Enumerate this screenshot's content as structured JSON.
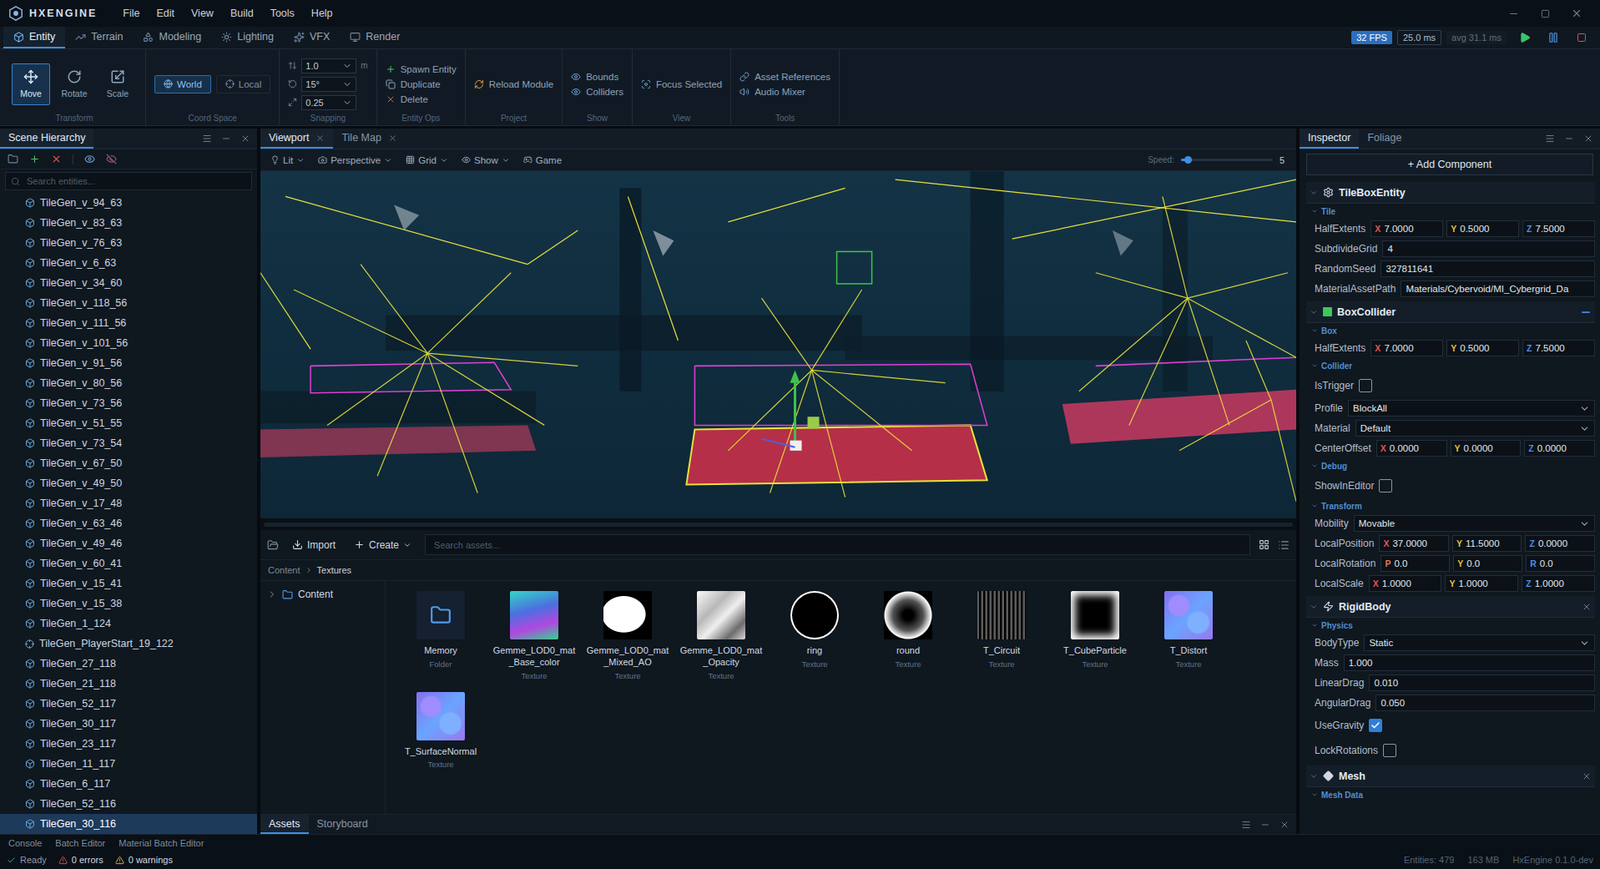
{
  "window": {
    "logo": "HXENGINE",
    "menu": [
      "File",
      "Edit",
      "View",
      "Build",
      "Tools",
      "Help"
    ]
  },
  "mode_tabs": [
    {
      "label": "Entity",
      "selected": true
    },
    {
      "label": "Terrain",
      "selected": false
    },
    {
      "label": "Modeling",
      "selected": false
    },
    {
      "label": "Lighting",
      "selected": false
    },
    {
      "label": "VFX",
      "selected": false
    },
    {
      "label": "Render",
      "selected": false
    }
  ],
  "perf": {
    "fps": "32 FPS",
    "frame": "25.0 ms",
    "avg": "avg 31.1 ms"
  },
  "ribbon": [
    {
      "title": "Transform",
      "kind": "tools",
      "items": [
        {
          "label": "Move",
          "selected": true
        },
        {
          "label": "Rotate",
          "selected": false
        },
        {
          "label": "Scale",
          "selected": false
        }
      ]
    },
    {
      "title": "Coord Space",
      "kind": "toggle",
      "items": [
        {
          "label": "World",
          "selected": true
        },
        {
          "label": "Local",
          "selected": false
        }
      ]
    },
    {
      "title": "Snapping",
      "kind": "snap",
      "items": [
        {
          "label": "1.0",
          "unit": "m"
        },
        {
          "label": "15°",
          "unit": ""
        },
        {
          "label": "0.25",
          "unit": ""
        }
      ]
    },
    {
      "title": "Entity Ops",
      "kind": "list",
      "items": [
        {
          "label": "Spawn Entity"
        },
        {
          "label": "Duplicate"
        },
        {
          "label": "Delete"
        }
      ]
    },
    {
      "title": "Project",
      "kind": "list",
      "items": [
        {
          "label": "Reload Module"
        }
      ]
    },
    {
      "title": "Show",
      "kind": "list",
      "items": [
        {
          "label": "Bounds"
        },
        {
          "label": "Colliders"
        }
      ]
    },
    {
      "title": "View",
      "kind": "list",
      "items": [
        {
          "label": "Focus Selected"
        }
      ]
    },
    {
      "title": "Tools",
      "kind": "list",
      "items": [
        {
          "label": "Asset References"
        },
        {
          "label": "Audio Mixer"
        }
      ]
    }
  ],
  "hierarchy": {
    "title": "Scene Hierarchy",
    "search_placeholder": "Search entities...",
    "items": [
      {
        "name": "TileGen_v_94_63",
        "kind": "entity",
        "selected": false
      },
      {
        "name": "TileGen_v_83_63",
        "kind": "entity",
        "selected": false
      },
      {
        "name": "TileGen_v_76_63",
        "kind": "entity",
        "selected": false
      },
      {
        "name": "TileGen_v_6_63",
        "kind": "entity",
        "selected": false
      },
      {
        "name": "TileGen_v_34_60",
        "kind": "entity",
        "selected": false
      },
      {
        "name": "TileGen_v_118_56",
        "kind": "entity",
        "selected": false
      },
      {
        "name": "TileGen_v_111_56",
        "kind": "entity",
        "selected": false
      },
      {
        "name": "TileGen_v_101_56",
        "kind": "entity",
        "selected": false
      },
      {
        "name": "TileGen_v_91_56",
        "kind": "entity",
        "selected": false
      },
      {
        "name": "TileGen_v_80_56",
        "kind": "entity",
        "selected": false
      },
      {
        "name": "TileGen_v_73_56",
        "kind": "entity",
        "selected": false
      },
      {
        "name": "TileGen_v_51_55",
        "kind": "entity",
        "selected": false
      },
      {
        "name": "TileGen_v_73_54",
        "kind": "entity",
        "selected": false
      },
      {
        "name": "TileGen_v_67_50",
        "kind": "entity",
        "selected": false
      },
      {
        "name": "TileGen_v_49_50",
        "kind": "entity",
        "selected": false
      },
      {
        "name": "TileGen_v_17_48",
        "kind": "entity",
        "selected": false
      },
      {
        "name": "TileGen_v_63_46",
        "kind": "entity",
        "selected": false
      },
      {
        "name": "TileGen_v_49_46",
        "kind": "entity",
        "selected": false
      },
      {
        "name": "TileGen_v_60_41",
        "kind": "entity",
        "selected": false
      },
      {
        "name": "TileGen_v_15_41",
        "kind": "entity",
        "selected": false
      },
      {
        "name": "TileGen_v_15_38",
        "kind": "entity",
        "selected": false
      },
      {
        "name": "TileGen_1_124",
        "kind": "entity",
        "selected": false
      },
      {
        "name": "TileGen_PlayerStart_19_122",
        "kind": "spawn",
        "selected": false
      },
      {
        "name": "TileGen_27_118",
        "kind": "entity",
        "selected": false
      },
      {
        "name": "TileGen_21_118",
        "kind": "entity",
        "selected": false
      },
      {
        "name": "TileGen_52_117",
        "kind": "entity",
        "selected": false
      },
      {
        "name": "TileGen_30_117",
        "kind": "entity",
        "selected": false
      },
      {
        "name": "TileGen_23_117",
        "kind": "entity",
        "selected": false
      },
      {
        "name": "TileGen_11_117",
        "kind": "entity",
        "selected": false
      },
      {
        "name": "TileGen_6_117",
        "kind": "entity",
        "selected": false
      },
      {
        "name": "TileGen_52_116",
        "kind": "entity",
        "selected": false
      },
      {
        "name": "TileGen_30_116",
        "kind": "entity",
        "selected": true
      }
    ]
  },
  "viewport": {
    "tabs": [
      {
        "label": "Viewport",
        "selected": true
      },
      {
        "label": "Tile Map",
        "selected": false
      }
    ],
    "toolbar": [
      {
        "label": "Lit",
        "caret": true
      },
      {
        "label": "Perspective",
        "caret": true
      },
      {
        "label": "Grid",
        "caret": true
      },
      {
        "label": "Show",
        "caret": true
      },
      {
        "label": "Game",
        "caret": false
      }
    ],
    "speed": {
      "label": "Speed:",
      "value": "5",
      "level": 0.08
    }
  },
  "assets": {
    "import": "Import",
    "create": "Create",
    "search_placeholder": "Search assets...",
    "breadcrumb": [
      "Content",
      "Textures"
    ],
    "tree": [
      {
        "label": "Content",
        "expanded": false
      }
    ],
    "items": [
      {
        "name": "Memory",
        "type": "Folder",
        "kind": "folder"
      },
      {
        "name": "Gemme_LOD0_mat_Base_color",
        "type": "Texture",
        "kind": "gradient"
      },
      {
        "name": "Gemme_LOD0_mat_Mixed_AO",
        "type": "Texture",
        "kind": "mask"
      },
      {
        "name": "Gemme_LOD0_mat_Opacity",
        "type": "Texture",
        "kind": "opacity"
      },
      {
        "name": "ring",
        "type": "Texture",
        "kind": "ring"
      },
      {
        "name": "round",
        "type": "Texture",
        "kind": "round"
      },
      {
        "name": "T_Circuit",
        "type": "Texture",
        "kind": "noise"
      },
      {
        "name": "T_CubeParticle",
        "type": "Texture",
        "kind": "square"
      },
      {
        "name": "T_Distort",
        "type": "Texture",
        "kind": "normal"
      },
      {
        "name": "T_SurfaceNormal",
        "type": "Texture",
        "kind": "normal"
      }
    ],
    "tabs": [
      {
        "label": "Assets",
        "selected": true
      },
      {
        "label": "Storyboard",
        "selected": false
      }
    ]
  },
  "inspector": {
    "tabs": [
      {
        "label": "Inspector",
        "selected": true
      },
      {
        "label": "Foliage",
        "selected": false
      }
    ],
    "add_component": "+ Add Component",
    "components": [
      {
        "name": "TileBoxEntity",
        "action": "none",
        "sections": [
          {
            "title": "Tile",
            "fields": [
              {
                "label": "HalfExtents",
                "kind": "vec3",
                "parts": [
                  {
                    "axis": "X",
                    "value": "7.0000"
                  },
                  {
                    "axis": "Y",
                    "value": "0.5000"
                  },
                  {
                    "axis": "Z",
                    "value": "7.5000"
                  }
                ]
              },
              {
                "label": "SubdivideGrid",
                "kind": "text",
                "value": "4"
              },
              {
                "label": "RandomSeed",
                "kind": "text",
                "value": "327811641"
              },
              {
                "label": "MaterialAssetPath",
                "kind": "text",
                "value": "Materials/Cybervoid/MI_Cybergrid_Da"
              }
            ]
          }
        ]
      },
      {
        "name": "BoxCollider",
        "action": "minus",
        "sections": [
          {
            "title": "Box",
            "fields": [
              {
                "label": "HalfExtents",
                "kind": "vec3",
                "parts": [
                  {
                    "axis": "X",
                    "value": "7.0000"
                  },
                  {
                    "axis": "Y",
                    "value": "0.5000"
                  },
                  {
                    "axis": "Z",
                    "value": "7.5000"
                  }
                ]
              }
            ]
          },
          {
            "title": "Collider",
            "fields": [
              {
                "label": "IsTrigger",
                "kind": "check",
                "checked": false
              },
              {
                "label": "Profile",
                "kind": "select",
                "value": "BlockAll"
              },
              {
                "label": "Material",
                "kind": "select",
                "value": "Default"
              },
              {
                "label": "CenterOffset",
                "kind": "vec3",
                "parts": [
                  {
                    "axis": "X",
                    "value": "0.0000"
                  },
                  {
                    "axis": "Y",
                    "value": "0.0000"
                  },
                  {
                    "axis": "Z",
                    "value": "0.0000"
                  }
                ]
              }
            ]
          },
          {
            "title": "Debug",
            "fields": [
              {
                "label": "ShowInEditor",
                "kind": "check",
                "checked": false
              }
            ]
          },
          {
            "title": "Transform",
            "fields": [
              {
                "label": "Mobility",
                "kind": "select",
                "value": "Movable"
              },
              {
                "label": "LocalPosition",
                "kind": "vec3",
                "parts": [
                  {
                    "axis": "X",
                    "value": "37.0000"
                  },
                  {
                    "axis": "Y",
                    "value": "11.5000"
                  },
                  {
                    "axis": "Z",
                    "value": "0.0000"
                  }
                ]
              },
              {
                "label": "LocalRotation",
                "kind": "vec3",
                "parts": [
                  {
                    "axis": "P",
                    "value": "0.0"
                  },
                  {
                    "axis": "Y",
                    "value": "0.0"
                  },
                  {
                    "axis": "R",
                    "value": "0.0"
                  }
                ]
              },
              {
                "label": "LocalScale",
                "kind": "vec3",
                "parts": [
                  {
                    "axis": "X",
                    "value": "1.0000"
                  },
                  {
                    "axis": "Y",
                    "value": "1.0000"
                  },
                  {
                    "axis": "Z",
                    "value": "1.0000"
                  }
                ]
              }
            ]
          }
        ]
      },
      {
        "name": "RigidBody",
        "action": "close",
        "sections": [
          {
            "title": "Physics",
            "fields": [
              {
                "label": "BodyType",
                "kind": "select",
                "value": "Static"
              },
              {
                "label": "Mass",
                "kind": "text",
                "value": "1.000"
              },
              {
                "label": "LinearDrag",
                "kind": "text",
                "value": "0.010"
              },
              {
                "label": "AngularDrag",
                "kind": "text",
                "value": "0.050"
              },
              {
                "label": "UseGravity",
                "kind": "check",
                "checked": true
              },
              {
                "label": "LockRotations",
                "kind": "check",
                "checked": false
              }
            ]
          }
        ]
      },
      {
        "name": "Mesh",
        "action": "close",
        "sections": [
          {
            "title": "Mesh Data",
            "fields": []
          }
        ]
      }
    ]
  },
  "dock_tabs": [
    "Console",
    "Batch Editor",
    "Material Batch Editor"
  ],
  "status_bar": {
    "state": "Ready",
    "errors": "0 errors",
    "warnings": "0 warnings",
    "entities": "Entities: 479",
    "memory": "163 MB",
    "version": "HxEngine 0.1.0-dev"
  }
}
